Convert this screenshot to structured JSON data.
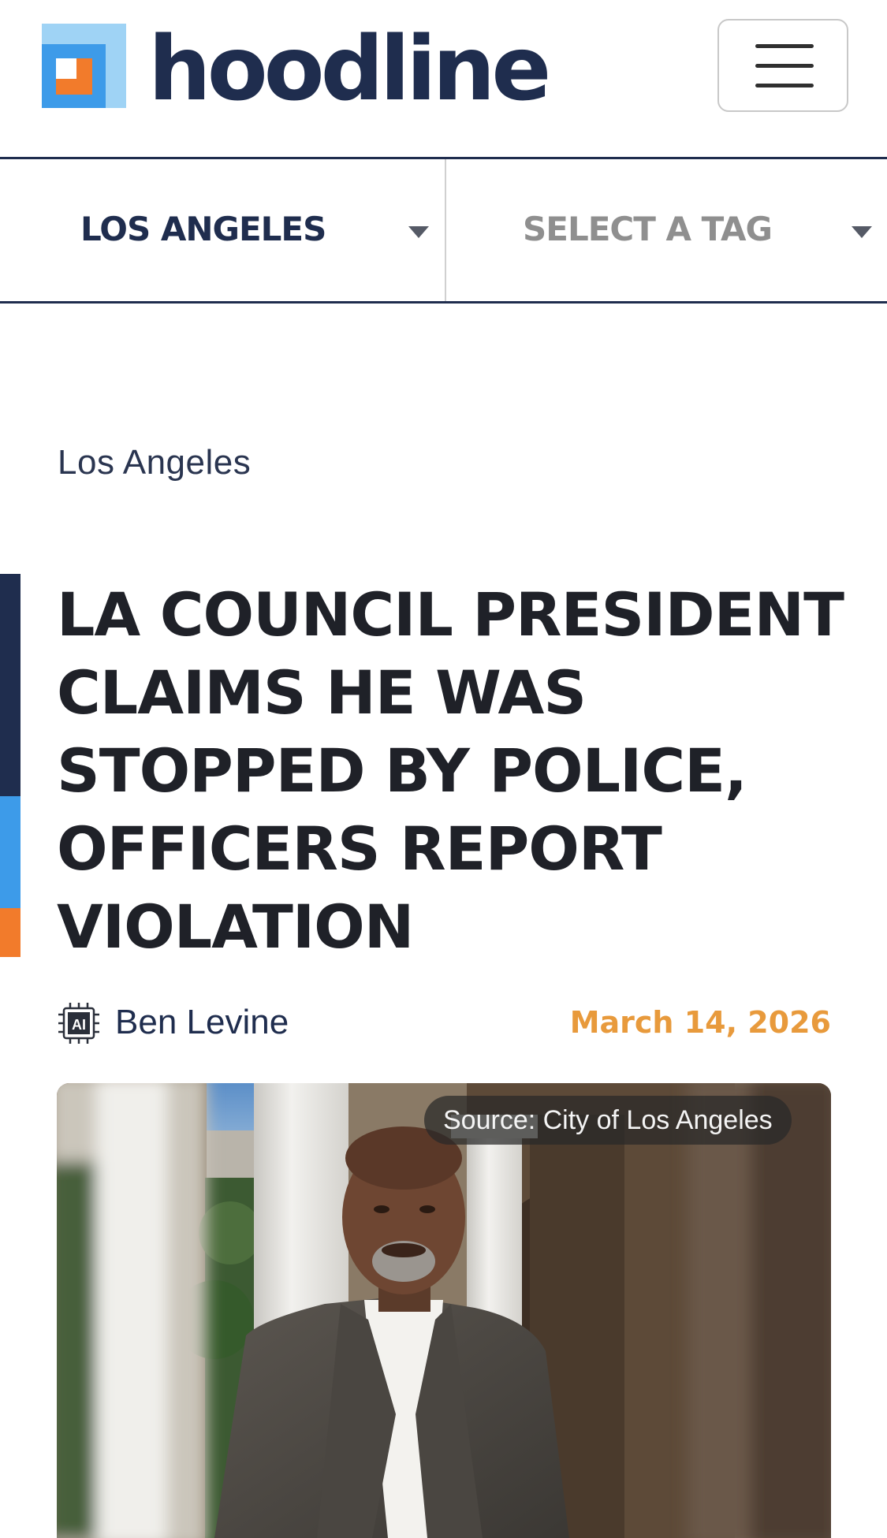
{
  "header": {
    "logo_text": "hoodline",
    "logo_icon": "hoodline-logo-icon",
    "menu_icon": "hamburger-menu-icon"
  },
  "filters": {
    "location_label": "LOS ANGELES",
    "tag_label": "SELECT A TAG",
    "caret_icon": "caret-down-icon"
  },
  "article": {
    "kicker": "Los Angeles",
    "headline": "LA COUNCIL PRESIDENT CLAIMS HE WAS STOPPED BY POLICE, OFFICERS REPORT VIOLATION",
    "author_icon": "ai-chip-icon",
    "author_badge": "AI",
    "author": "Ben Levine",
    "date": "March 14, 2026",
    "image_source": "Source: City of Los Angeles"
  },
  "colors": {
    "brand_navy": "#1f2d4e",
    "brand_blue": "#3d9be9",
    "brand_orange": "#f27b2b",
    "date_gold": "#e89a3c"
  }
}
